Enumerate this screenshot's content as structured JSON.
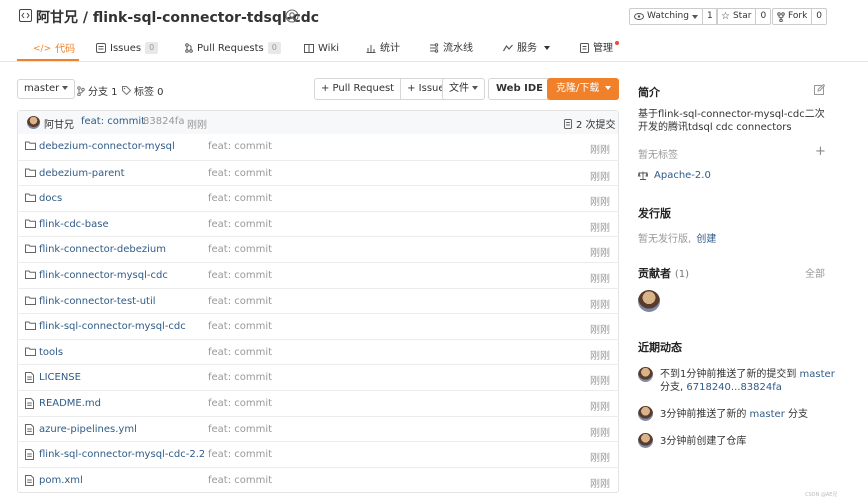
{
  "header": {
    "owner": "阿甘兄",
    "sep": "/",
    "repo": "flink-sql-connector-tdsql-cdc",
    "watch_label": "Watching",
    "watch_count": "1",
    "star_label": "Star",
    "star_count": "0",
    "fork_label": "Fork",
    "fork_count": "0"
  },
  "tabs": [
    {
      "label": "代码",
      "icon": "code-icon",
      "active": true
    },
    {
      "label": "Issues",
      "icon": "issues-icon",
      "badge": "0"
    },
    {
      "label": "Pull Requests",
      "icon": "pull-request-icon",
      "badge": "0"
    },
    {
      "label": "Wiki",
      "icon": "wiki-icon"
    },
    {
      "label": "统计",
      "icon": "stats-icon"
    },
    {
      "label": "流水线",
      "icon": "pipeline-icon"
    },
    {
      "label": "服务",
      "icon": "service-icon"
    },
    {
      "label": "管理",
      "icon": "manage-icon"
    }
  ],
  "toolbar": {
    "branch": "master",
    "branches": "分支 1",
    "tags": "标签 0",
    "pull_request": "+ Pull Request",
    "issue": "+ Issue",
    "file": "文件",
    "web_ide": "Web IDE",
    "clone": "克隆/下载"
  },
  "commit_bar": {
    "author": "阿甘兄",
    "message": "feat: commit",
    "hash": "83824fa",
    "time": "刚刚",
    "commits": "2 次提交"
  },
  "files": [
    {
      "name": "debezium-connector-mysql",
      "type": "folder",
      "msg": "feat: commit",
      "time": "刚刚"
    },
    {
      "name": "debezium-parent",
      "type": "folder",
      "msg": "feat: commit",
      "time": "刚刚"
    },
    {
      "name": "docs",
      "type": "folder",
      "msg": "feat: commit",
      "time": "刚刚"
    },
    {
      "name": "flink-cdc-base",
      "type": "folder",
      "msg": "feat: commit",
      "time": "刚刚"
    },
    {
      "name": "flink-connector-debezium",
      "type": "folder",
      "msg": "feat: commit",
      "time": "刚刚"
    },
    {
      "name": "flink-connector-mysql-cdc",
      "type": "folder",
      "msg": "feat: commit",
      "time": "刚刚"
    },
    {
      "name": "flink-connector-test-util",
      "type": "folder",
      "msg": "feat: commit",
      "time": "刚刚"
    },
    {
      "name": "flink-sql-connector-mysql-cdc",
      "type": "folder",
      "msg": "feat: commit",
      "time": "刚刚"
    },
    {
      "name": "tools",
      "type": "folder",
      "msg": "feat: commit",
      "time": "刚刚"
    },
    {
      "name": "LICENSE",
      "type": "file",
      "msg": "feat: commit",
      "time": "刚刚"
    },
    {
      "name": "README.md",
      "type": "file",
      "msg": "feat: commit",
      "time": "刚刚"
    },
    {
      "name": "azure-pipelines.yml",
      "type": "file",
      "msg": "feat: commit",
      "time": "刚刚"
    },
    {
      "name": "flink-sql-connector-mysql-cdc-2.2-...",
      "type": "file",
      "msg": "feat: commit",
      "time": "刚刚"
    },
    {
      "name": "pom.xml",
      "type": "file",
      "msg": "feat: commit",
      "time": "刚刚"
    }
  ],
  "sidebar": {
    "intro_title": "简介",
    "intro_text": "基于flink-sql-connector-mysql-cdc二次开发的腾讯tdsql cdc connectors",
    "no_tags": "暂无标签",
    "license": "Apache-2.0",
    "release_title": "发行版",
    "no_release": "暂无发行版,",
    "create": "创建",
    "contrib_title": "贡献者",
    "contrib_count": "(1)",
    "all": "全部",
    "activity_title": "近期动态",
    "activities": [
      {
        "pre": "不到1分钟前推送了新的提交到 ",
        "branch": "master",
        "line2a": "分支,",
        "line2b": "6718240...83824fa"
      },
      {
        "pre": "3分钟前推送了新的 ",
        "branch": "master",
        "post": " 分支"
      },
      {
        "pre": "3分钟前创建了仓库"
      }
    ]
  },
  "colors": {
    "accent": "#f0812a",
    "link": "#2f5b87",
    "muted": "#999999"
  },
  "watermark": "CSDN @AE兄"
}
